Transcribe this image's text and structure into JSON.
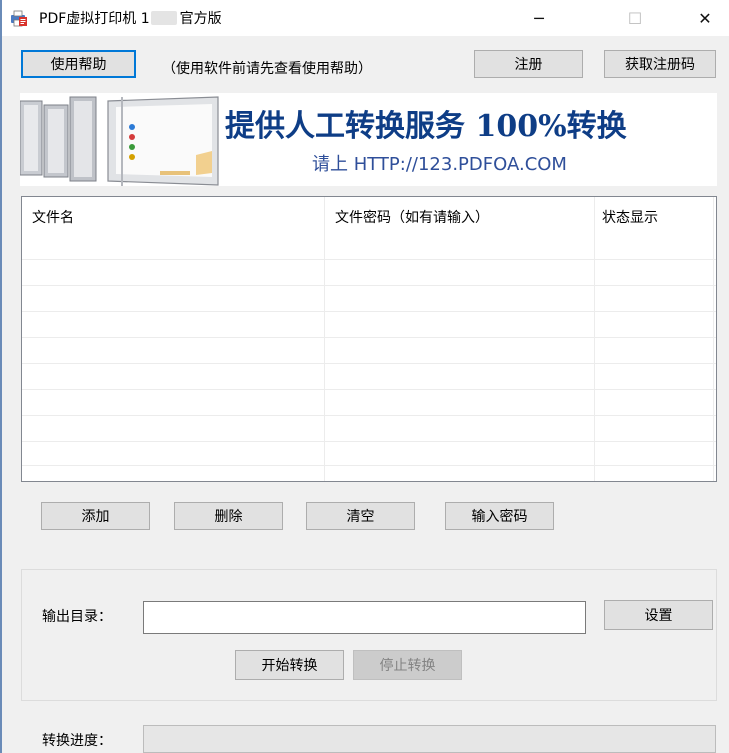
{
  "window": {
    "title_prefix": "PDF虚拟打印机 1",
    "title_suffix": "官方版",
    "minimize_glyph": "─",
    "maximize_glyph": "☐",
    "close_glyph": "✕"
  },
  "toolbar": {
    "help_label": "使用帮助",
    "hint": "（使用软件前请先查看使用帮助）",
    "register_label": "注册",
    "get_code_label": "获取注册码"
  },
  "banner": {
    "headline": "提供人工转换服务 100%转换",
    "url_line": "请上  HTTP://123.PDFOA.COM"
  },
  "file_list": {
    "columns": [
      "文件名",
      "文件密码（如有请输入）",
      "状态显示"
    ],
    "rows": []
  },
  "list_actions": {
    "add_label": "添加",
    "delete_label": "删除",
    "clear_label": "清空",
    "password_label": "输入密码"
  },
  "output": {
    "dir_label": "输出目录：",
    "dir_value": "",
    "settings_label": "设置",
    "start_label": "开始转换",
    "stop_label": "停止转换"
  },
  "progress": {
    "label": "转换进度：",
    "value": 0
  },
  "colors": {
    "banner_text": "#0e3d86",
    "focus_border": "#0078d7",
    "window_bg": "#f0f0f0",
    "titlebar_icon": "pdf-printer-icon"
  }
}
